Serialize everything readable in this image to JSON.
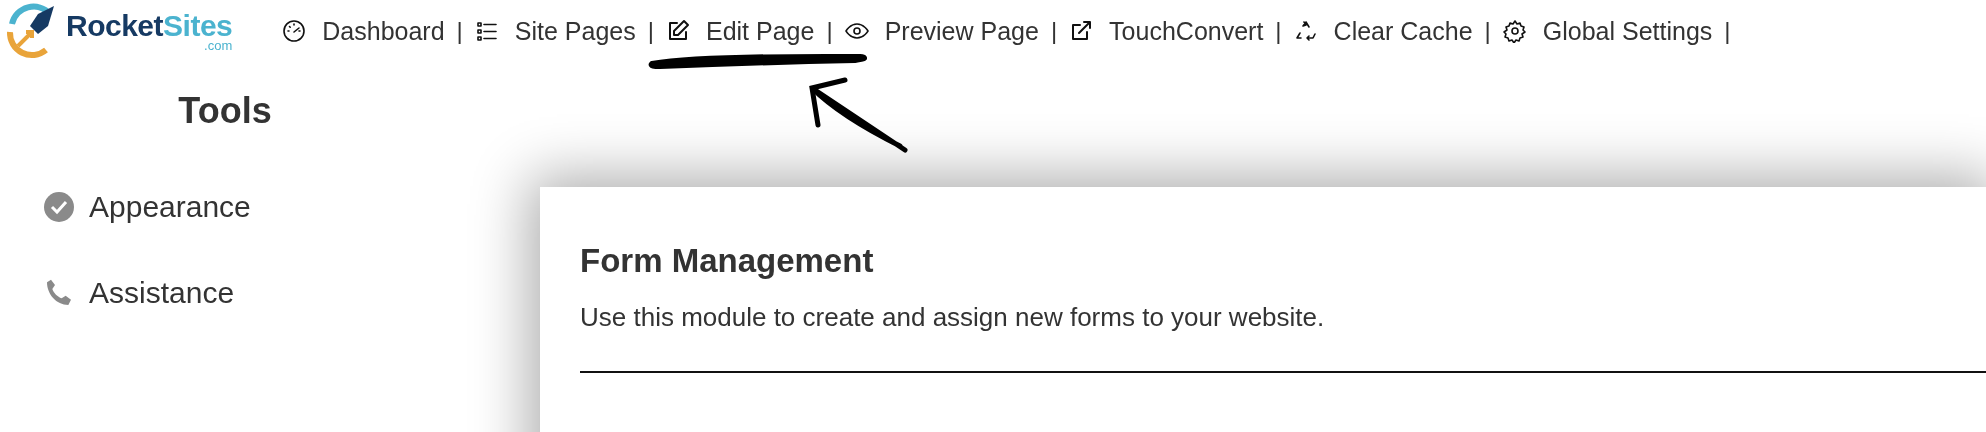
{
  "logo": {
    "name_part_1": "Rocket",
    "name_part_2": "Sites",
    "domain": ".com"
  },
  "nav": [
    {
      "label": "Dashboard",
      "separator": "|"
    },
    {
      "label": "Site Pages",
      "separator": "|"
    },
    {
      "label": "Edit Page",
      "separator": "|"
    },
    {
      "label": "Preview Page",
      "separator": "|"
    },
    {
      "label": "TouchConvert",
      "separator": "|"
    },
    {
      "label": "Clear Cache",
      "separator": "|"
    },
    {
      "label": "Global Settings",
      "separator": "|"
    }
  ],
  "sidebar": {
    "title": "Tools",
    "items": [
      {
        "label": "Appearance"
      },
      {
        "label": "Assistance"
      }
    ]
  },
  "panel": {
    "title": "Form Management",
    "description": "Use this module to create and assign new forms to your website."
  }
}
